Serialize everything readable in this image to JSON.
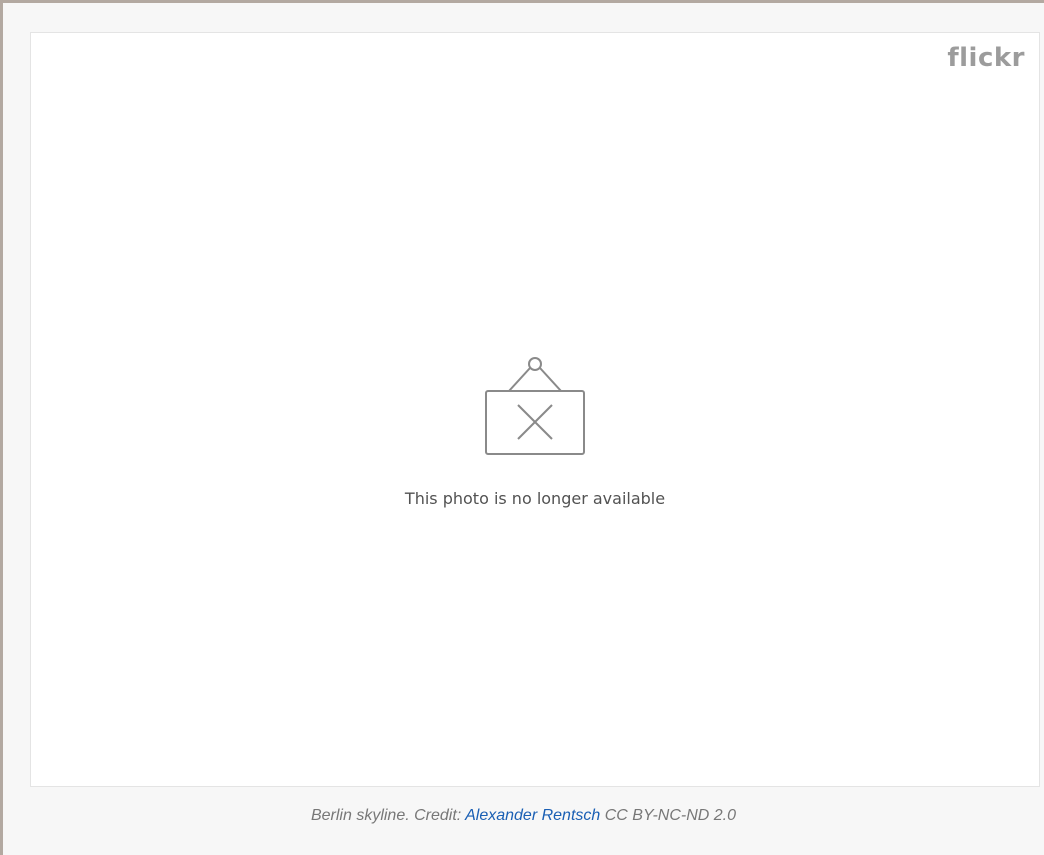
{
  "embed": {
    "logo_text": "flickr",
    "unavailable_icon": "broken-picture-frame-icon",
    "unavailable_message": "This photo is no longer available"
  },
  "caption": {
    "prefix": "Berlin skyline. Credit: ",
    "author_link": "Alexander Rentsch",
    "license": "CC BY-NC-ND 2.0"
  },
  "colors": {
    "frame_border": "#b3a9a1",
    "frame_background": "#f7f7f7",
    "logo": "#9c9c9c",
    "link": "#1a5fb4",
    "caption_text": "#777777"
  }
}
